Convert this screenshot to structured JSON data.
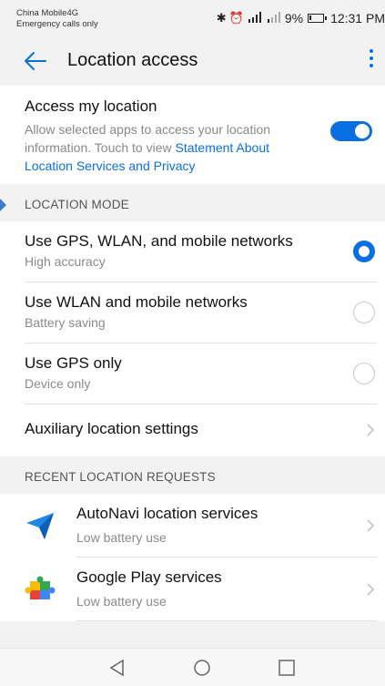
{
  "status_bar": {
    "carrier_line1": "China Mobile4G",
    "carrier_line2": "Emergency calls only",
    "icons": [
      "bluetooth-icon",
      "alarm-icon",
      "signal-4g-icon",
      "signal-icon"
    ],
    "battery_percent": "9%",
    "time": "12:31 PM"
  },
  "app_bar": {
    "title": "Location access",
    "accent": "#0a6fe0"
  },
  "access": {
    "title": "Access my location",
    "description": "Allow selected apps to access your location information. Touch to view ",
    "link_text": "Statement About Location Services and Privacy",
    "enabled": true
  },
  "location_mode": {
    "header": "LOCATION MODE",
    "options": [
      {
        "title": "Use GPS, WLAN, and mobile networks",
        "subtitle": "High accuracy",
        "selected": true
      },
      {
        "title": "Use WLAN and mobile networks",
        "subtitle": "Battery saving",
        "selected": false
      },
      {
        "title": "Use GPS only",
        "subtitle": "Device only",
        "selected": false
      }
    ],
    "auxiliary": "Auxiliary location settings"
  },
  "recent_requests": {
    "header": "RECENT LOCATION REQUESTS",
    "items": [
      {
        "icon": "autonavi-icon",
        "title": "AutoNavi location services",
        "subtitle": "Low battery use"
      },
      {
        "icon": "google-play-services-icon",
        "title": "Google Play services",
        "subtitle": "Low battery use"
      }
    ]
  },
  "nav_bar": {
    "buttons": [
      "back-triangle-icon",
      "home-circle-icon",
      "recents-square-icon"
    ]
  }
}
